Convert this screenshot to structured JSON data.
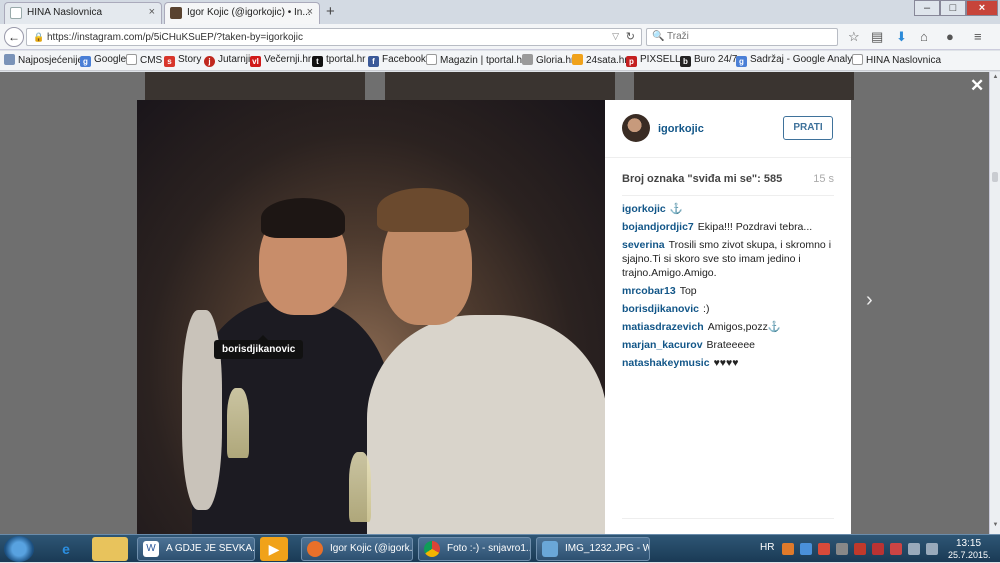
{
  "browser": {
    "tabs": [
      {
        "label": "HINA Naslovnica"
      },
      {
        "label": "Igor Kojic (@igorkojic) • In..."
      }
    ],
    "url": "https://instagram.com/p/5iCHuKSuEP/?taken-by=igorkojic",
    "search_placeholder": "Traži",
    "bookmarks": [
      {
        "label": "Najposjećenije",
        "icon": "page-icon"
      },
      {
        "label": "Google",
        "icon": "google-icon"
      },
      {
        "label": "CMS",
        "icon": "page-icon"
      },
      {
        "label": "Story",
        "icon": "story-icon"
      },
      {
        "label": "Jutarnji",
        "icon": "jutarnji-icon"
      },
      {
        "label": "Večernji.hr",
        "icon": "vl-icon"
      },
      {
        "label": "tportal.hr",
        "icon": "tportal-icon"
      },
      {
        "label": "Facebook",
        "icon": "facebook-icon"
      },
      {
        "label": "Magazin | tportal.hr",
        "icon": "page-icon"
      },
      {
        "label": "Gloria.hr",
        "icon": "gloria-icon"
      },
      {
        "label": "24sata.hr",
        "icon": "24sata-icon"
      },
      {
        "label": "PIXSELL",
        "icon": "pixsell-icon"
      },
      {
        "label": "Buro 24/7",
        "icon": "buro-icon"
      },
      {
        "label": "Sadržaj - Google Analy...",
        "icon": "google-icon"
      },
      {
        "label": "HINA Naslovnica",
        "icon": "page-icon"
      }
    ]
  },
  "post": {
    "username": "igorkojic",
    "follow_label": "PRATI",
    "likes": "Broj oznaka \"sviđa mi se\": 585",
    "time": "15 s",
    "photo_tag": "borisdjikanovic",
    "comments": [
      {
        "user": "igorkojic",
        "text": "⚓"
      },
      {
        "user": "bojandjordjic7",
        "text": "Ekipa!!! Pozdravi tebra..."
      },
      {
        "user": "severina",
        "text": "Trosili smo zivot skupa, i skromno i sjajno.Ti si skoro sve sto imam jedino i trajno.Amigo.Amigo."
      },
      {
        "user": "mrcobar13",
        "text": "Top"
      },
      {
        "user": "borisdjikanovic",
        "text": ":)"
      },
      {
        "user": "matiasdrazevich",
        "text": "Amigos,pozz⚓"
      },
      {
        "user": "marjan_kacurov",
        "text": "Brateeeee"
      },
      {
        "user": "natashakeymusic",
        "text": "♥♥♥♥"
      }
    ]
  },
  "taskbar": {
    "buttons": [
      {
        "label": "A GDJE JE SEVKA....",
        "icon": "word-icon"
      },
      {
        "label": "Igor Kojic (@igork...",
        "icon": "firefox-icon"
      },
      {
        "label": "Foto :-) - snjavro1...",
        "icon": "chrome-icon"
      },
      {
        "label": "IMG_1232.JPG - W...",
        "icon": "photo-viewer-icon"
      }
    ],
    "language": "HR",
    "time": "13:15",
    "date": "25.7.2015."
  }
}
